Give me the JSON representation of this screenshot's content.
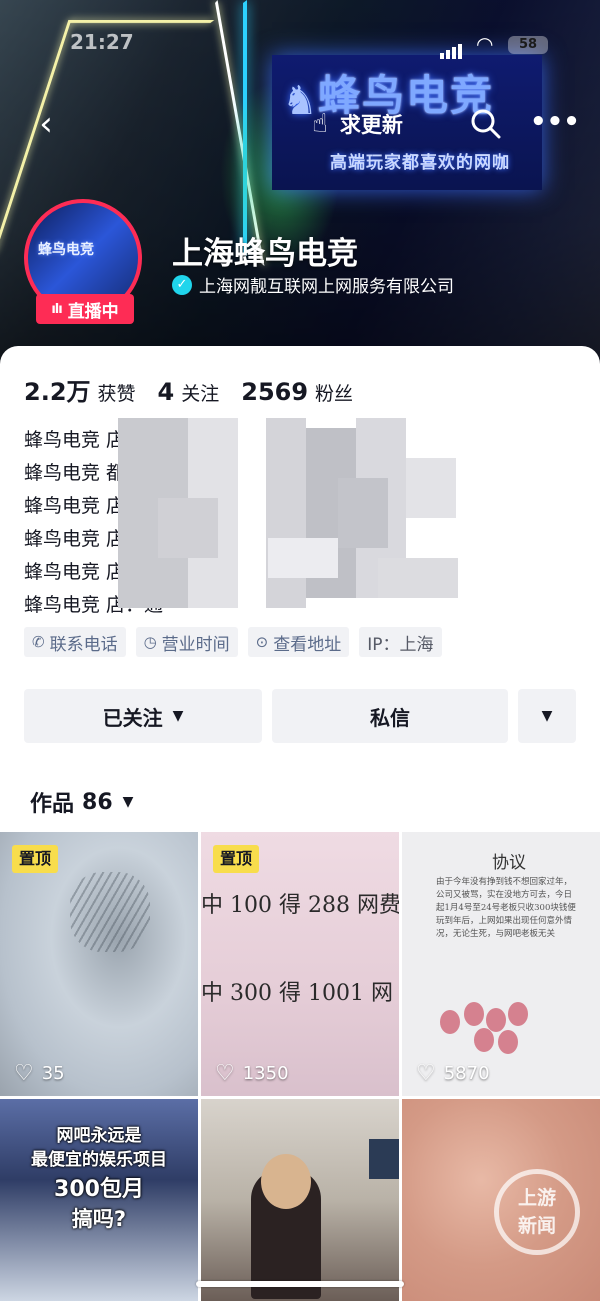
{
  "status_bar": {
    "time": "21:27",
    "battery": "58"
  },
  "cover_sign": {
    "title": "蜂鸟电竞",
    "subtitle": "高端玩家都喜欢的网咖"
  },
  "top_bar": {
    "update_label": "求更新"
  },
  "profile": {
    "name": "上海蜂鸟电竞",
    "live_label": "直播中",
    "avatar_text": "蜂鸟电竞",
    "verified_text": "上海网靓互联网上网服务有限公司"
  },
  "stats": [
    {
      "value": "2.2万",
      "label": "获赞"
    },
    {
      "value": "4",
      "label": "关注"
    },
    {
      "value": "2569",
      "label": "粉丝"
    }
  ],
  "bio_lines": [
    "蜂鸟电竞 店：富",
    "蜂鸟电竞 都店：七",
    "蜂鸟电竞 店：莘",
    "蜂鸟电竞 店：",
    "蜂鸟电竞 店：",
    "蜂鸟电竞 店：通"
  ],
  "tags": {
    "phone": "联系电话",
    "hours": "营业时间",
    "address": "查看地址",
    "ip": "IP：上海"
  },
  "buttons": {
    "follow": "已关注",
    "message": "私信"
  },
  "works": {
    "label": "作品",
    "count": "86"
  },
  "videos": [
    {
      "pinned": "置顶",
      "likes": "35"
    },
    {
      "pinned": "置顶",
      "likes": "1350",
      "line1": "中 100 得 288 网费",
      "line2": "中 300 得 1001 网"
    },
    {
      "likes": "5870",
      "doc_title": "协议",
      "doc_body": "由于今年没有挣到钱不想回家过年，公司又被骂，实在没地方可去，今日起1月4号至24号老板只收300块钱便玩到年后，上网如果出现任何意外情况，无论生死，与网吧老板无关"
    },
    {
      "caption1": "网吧永远是",
      "caption2": "最便宜的娱乐项目",
      "caption3": "300包月",
      "caption4": "搞吗?"
    },
    {},
    {
      "watermark_line1": "上游",
      "watermark_line2": "新闻"
    }
  ]
}
